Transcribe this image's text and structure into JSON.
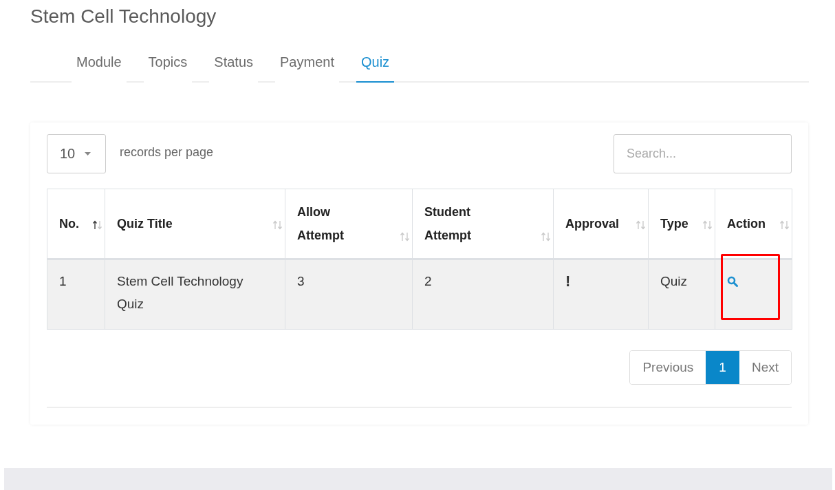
{
  "title": "Stem Cell Technology",
  "tabs": [
    {
      "label": "Module",
      "selected": false
    },
    {
      "label": "Topics",
      "selected": false
    },
    {
      "label": "Status",
      "selected": false
    },
    {
      "label": "Payment",
      "selected": false
    },
    {
      "label": "Quiz",
      "selected": true
    }
  ],
  "page_size": {
    "value": "10",
    "label": "records per page"
  },
  "search": {
    "placeholder": "Search..."
  },
  "table": {
    "columns": [
      {
        "label": "No.",
        "sorted": true
      },
      {
        "label": "Quiz Title",
        "sorted": false
      },
      {
        "label": "Allow Attempt",
        "sorted": false
      },
      {
        "label": "Student Attempt",
        "sorted": false
      },
      {
        "label": "Approval",
        "sorted": false
      },
      {
        "label": "Type",
        "sorted": false
      },
      {
        "label": "Action",
        "sorted": false
      }
    ],
    "rows": [
      {
        "no": "1",
        "quiz_title": "Stem Cell Technology Quiz",
        "allow_attempt": "3",
        "student_attempt": "2",
        "approval": "!",
        "type": "Quiz",
        "action_highlighted": true
      }
    ]
  },
  "pagination": [
    {
      "label": "Previous",
      "selected": false
    },
    {
      "label": "1",
      "selected": true
    },
    {
      "label": "Next",
      "selected": false
    }
  ]
}
